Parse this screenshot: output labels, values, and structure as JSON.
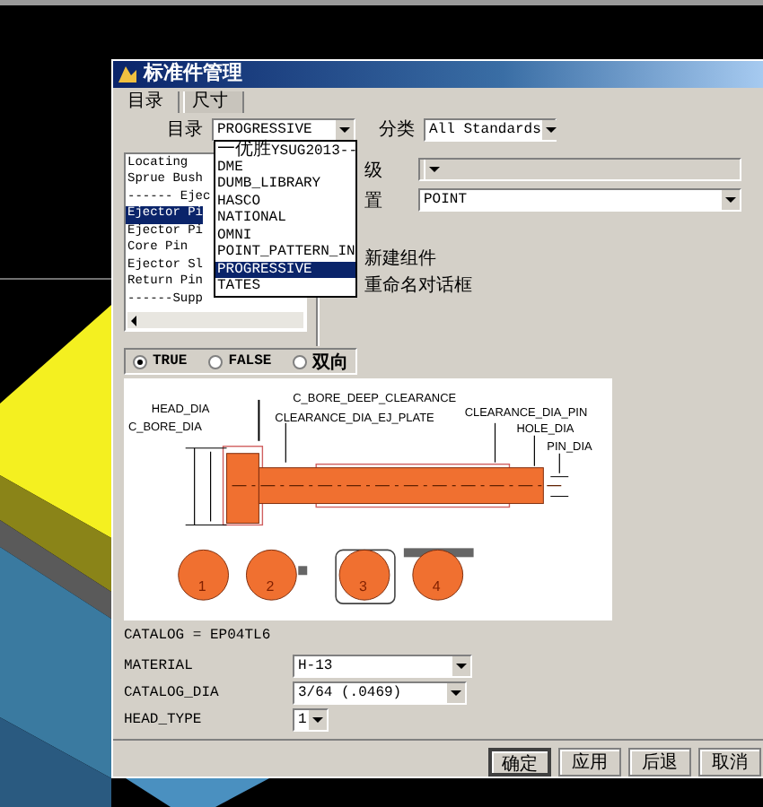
{
  "window": {
    "title": "标准件管理"
  },
  "tabs": [
    {
      "label": "目录",
      "selected": true
    },
    {
      "label": "尺寸",
      "selected": false
    }
  ],
  "filters": [
    {
      "label": "目录",
      "value": "PROGRESSIVE"
    },
    {
      "label": "分类",
      "value": "All Standards"
    }
  ],
  "category_list": [
    {
      "label": "Locating",
      "selected": false
    },
    {
      "label": "Sprue Bush",
      "selected": false
    },
    {
      "label": "------ Ejec",
      "selected": false
    },
    {
      "label": "Ejector Pi",
      "selected": true
    },
    {
      "label": "Ejector Pi",
      "selected": false
    },
    {
      "label": "Core Pin",
      "selected": false
    },
    {
      "label": "Ejector Sl",
      "selected": false
    },
    {
      "label": "Return Pin",
      "selected": false
    },
    {
      "label": "------Supp",
      "selected": false
    }
  ],
  "catalog_dropdown": [
    {
      "label": "一优胜YSUG2013--",
      "selected": false
    },
    {
      "label": "DME",
      "selected": false
    },
    {
      "label": "DUMB_LIBRARY",
      "selected": false
    },
    {
      "label": "HASCO",
      "selected": false
    },
    {
      "label": "NATIONAL",
      "selected": false
    },
    {
      "label": "OMNI",
      "selected": false
    },
    {
      "label": "POINT_PATTERN_IN",
      "selected": false
    },
    {
      "label": "PROGRESSIVE",
      "selected": true
    },
    {
      "label": "TATES",
      "selected": false
    }
  ],
  "settings": {
    "fields": [
      {
        "label": "级",
        "disabled": true
      },
      {
        "label": "置",
        "value": "POINT",
        "disabled": false
      }
    ],
    "options": [
      "新建组件",
      "重命名对话框"
    ]
  },
  "radios": [
    {
      "label": "TRUE",
      "selected": true
    },
    {
      "label": "FALSE",
      "selected": false
    },
    {
      "label": "双向",
      "selected": false
    }
  ],
  "diagram": {
    "labels": [
      "HEAD_DIA",
      "C_BORE_DIA",
      "C_BORE_DEEP_CLEARANCE",
      "CLEARANCE_DIA_EJ_PLATE",
      "CLEARANCE_DIA_PIN",
      "HOLE_DIA",
      "PIN_DIA"
    ],
    "positions": [
      "1",
      "2",
      "3",
      "4"
    ]
  },
  "catalog": "CATALOG = EP04TL6",
  "parameters": [
    {
      "label": "MATERIAL",
      "value": "H-13"
    },
    {
      "label": "CATALOG_DIA",
      "value": "3/64 (.0469)"
    },
    {
      "label": "HEAD_TYPE",
      "value": "1"
    }
  ],
  "buttons": [
    {
      "label": "确定",
      "default": true
    },
    {
      "label": "应用",
      "default": false
    },
    {
      "label": "后退",
      "default": false
    },
    {
      "label": "取消",
      "default": false
    }
  ]
}
